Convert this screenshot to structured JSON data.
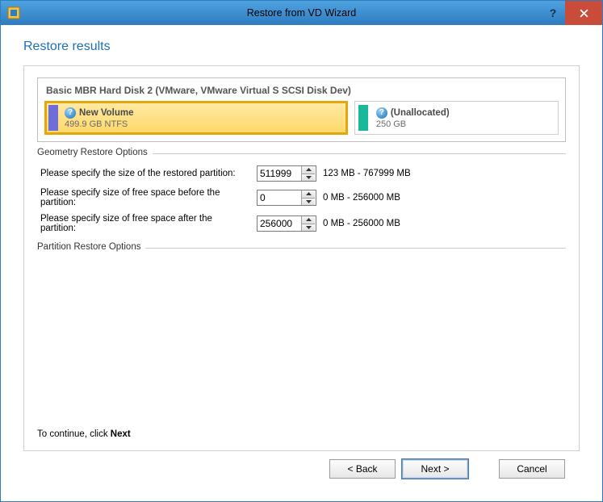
{
  "window": {
    "title": "Restore from VD Wizard"
  },
  "page": {
    "heading": "Restore results"
  },
  "disk": {
    "title": "Basic MBR Hard Disk 2 (VMware, VMware Virtual S SCSI Disk Dev)",
    "partitions": {
      "selected": {
        "name": "New Volume",
        "detail": "499.9 GB NTFS"
      },
      "unallocated": {
        "name": "(Unallocated)",
        "detail": "250 GB"
      }
    }
  },
  "geometry": {
    "group_label": "Geometry Restore Options",
    "size": {
      "label": "Please specify the size of the restored partition:",
      "value": "511999",
      "range": "123 MB - 767999 MB"
    },
    "before": {
      "label": "Please specify size of free space before the partition:",
      "value": "0",
      "range": "0 MB - 256000 MB"
    },
    "after": {
      "label": "Please specify size of free space after the partition:",
      "value": "256000",
      "range": "0 MB - 256000 MB"
    }
  },
  "partition_restore": {
    "group_label": "Partition Restore Options"
  },
  "continue": {
    "prefix": "To continue, click ",
    "bold": "Next"
  },
  "buttons": {
    "back": "< Back",
    "next": "Next >",
    "cancel": "Cancel"
  }
}
